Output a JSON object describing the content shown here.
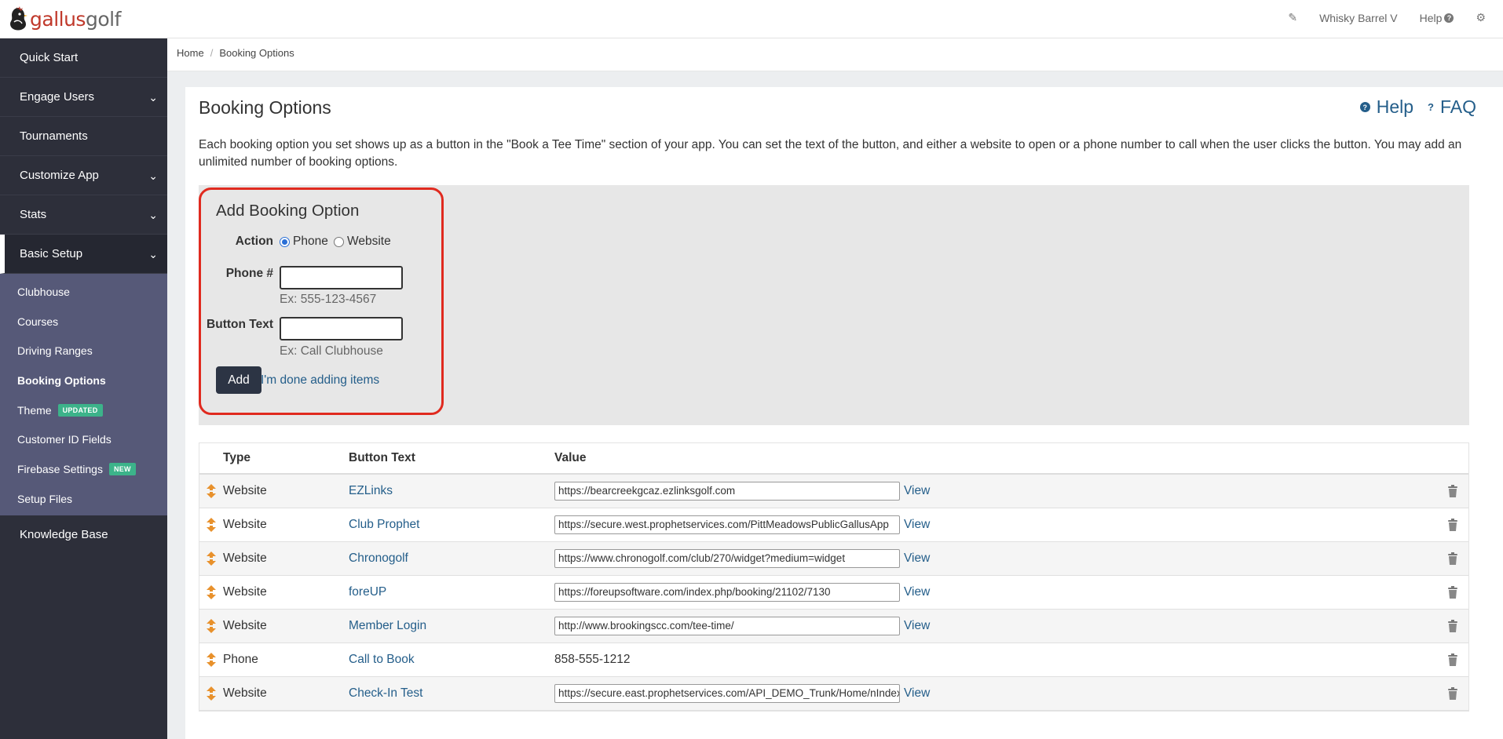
{
  "app": {
    "logo_part1": "gallus",
    "logo_part2": "golf"
  },
  "topbar": {
    "course_name": "Whisky Barrel V",
    "help_label": "Help"
  },
  "sidebar": {
    "items": [
      {
        "label": "Quick Start"
      },
      {
        "label": "Engage Users"
      },
      {
        "label": "Tournaments"
      },
      {
        "label": "Customize App"
      },
      {
        "label": "Stats"
      },
      {
        "label": "Basic Setup"
      },
      {
        "label": "Knowledge Base"
      }
    ],
    "sub_items": [
      {
        "label": "Clubhouse"
      },
      {
        "label": "Courses"
      },
      {
        "label": "Driving Ranges"
      },
      {
        "label": "Booking Options"
      },
      {
        "label": "Theme",
        "badge": "UPDATED"
      },
      {
        "label": "Customer ID Fields"
      },
      {
        "label": "Firebase Settings",
        "badge": "NEW"
      },
      {
        "label": "Setup Files"
      }
    ]
  },
  "breadcrumb": {
    "home": "Home",
    "current": "Booking Options"
  },
  "page": {
    "title": "Booking Options",
    "help_link": "Help",
    "faq_link": "FAQ",
    "description": "Each booking option you set shows up as a button in the \"Book a Tee Time\" section of your app. You can set the text of the button, and either a website to open or a phone number to call when the user clicks the button. You may add an unlimited number of booking options."
  },
  "add_form": {
    "title": "Add Booking Option",
    "action_label": "Action",
    "action_options": [
      "Phone",
      "Website"
    ],
    "action_selected": "Phone",
    "phone_label": "Phone #",
    "phone_value": "",
    "phone_hint": "Ex: 555-123-4567",
    "button_text_label": "Button Text",
    "button_text_value": "",
    "button_text_hint": "Ex: Call Clubhouse",
    "add_button": "Add",
    "done_link": "I'm done adding items"
  },
  "table": {
    "headers": [
      "Type",
      "Button Text",
      "Value"
    ],
    "view_label": "View",
    "rows": [
      {
        "type": "Website",
        "button_text": "EZLinks",
        "value": "https://bearcreekgcaz.ezlinksgolf.com"
      },
      {
        "type": "Website",
        "button_text": "Club Prophet",
        "value": "https://secure.west.prophetservices.com/PittMeadowsPublicGallusApp"
      },
      {
        "type": "Website",
        "button_text": "Chronogolf",
        "value": "https://www.chronogolf.com/club/270/widget?medium=widget"
      },
      {
        "type": "Website",
        "button_text": "foreUP",
        "value": "https://foreupsoftware.com/index.php/booking/21102/7130"
      },
      {
        "type": "Website",
        "button_text": "Member Login",
        "value": "http://www.brookingscc.com/tee-time/"
      },
      {
        "type": "Phone",
        "button_text": "Call to Book",
        "value": "858-555-1212"
      },
      {
        "type": "Website",
        "button_text": "Check-In Test",
        "value": "https://secure.east.prophetservices.com/API_DEMO_Trunk/Home/nIndex"
      }
    ]
  },
  "colors": {
    "sidebar_bg": "#2d2f3a",
    "sub_nav_bg": "#565978",
    "link": "#245e8a",
    "highlight_border": "#e02a1f",
    "badge_green": "#3cb38a"
  }
}
